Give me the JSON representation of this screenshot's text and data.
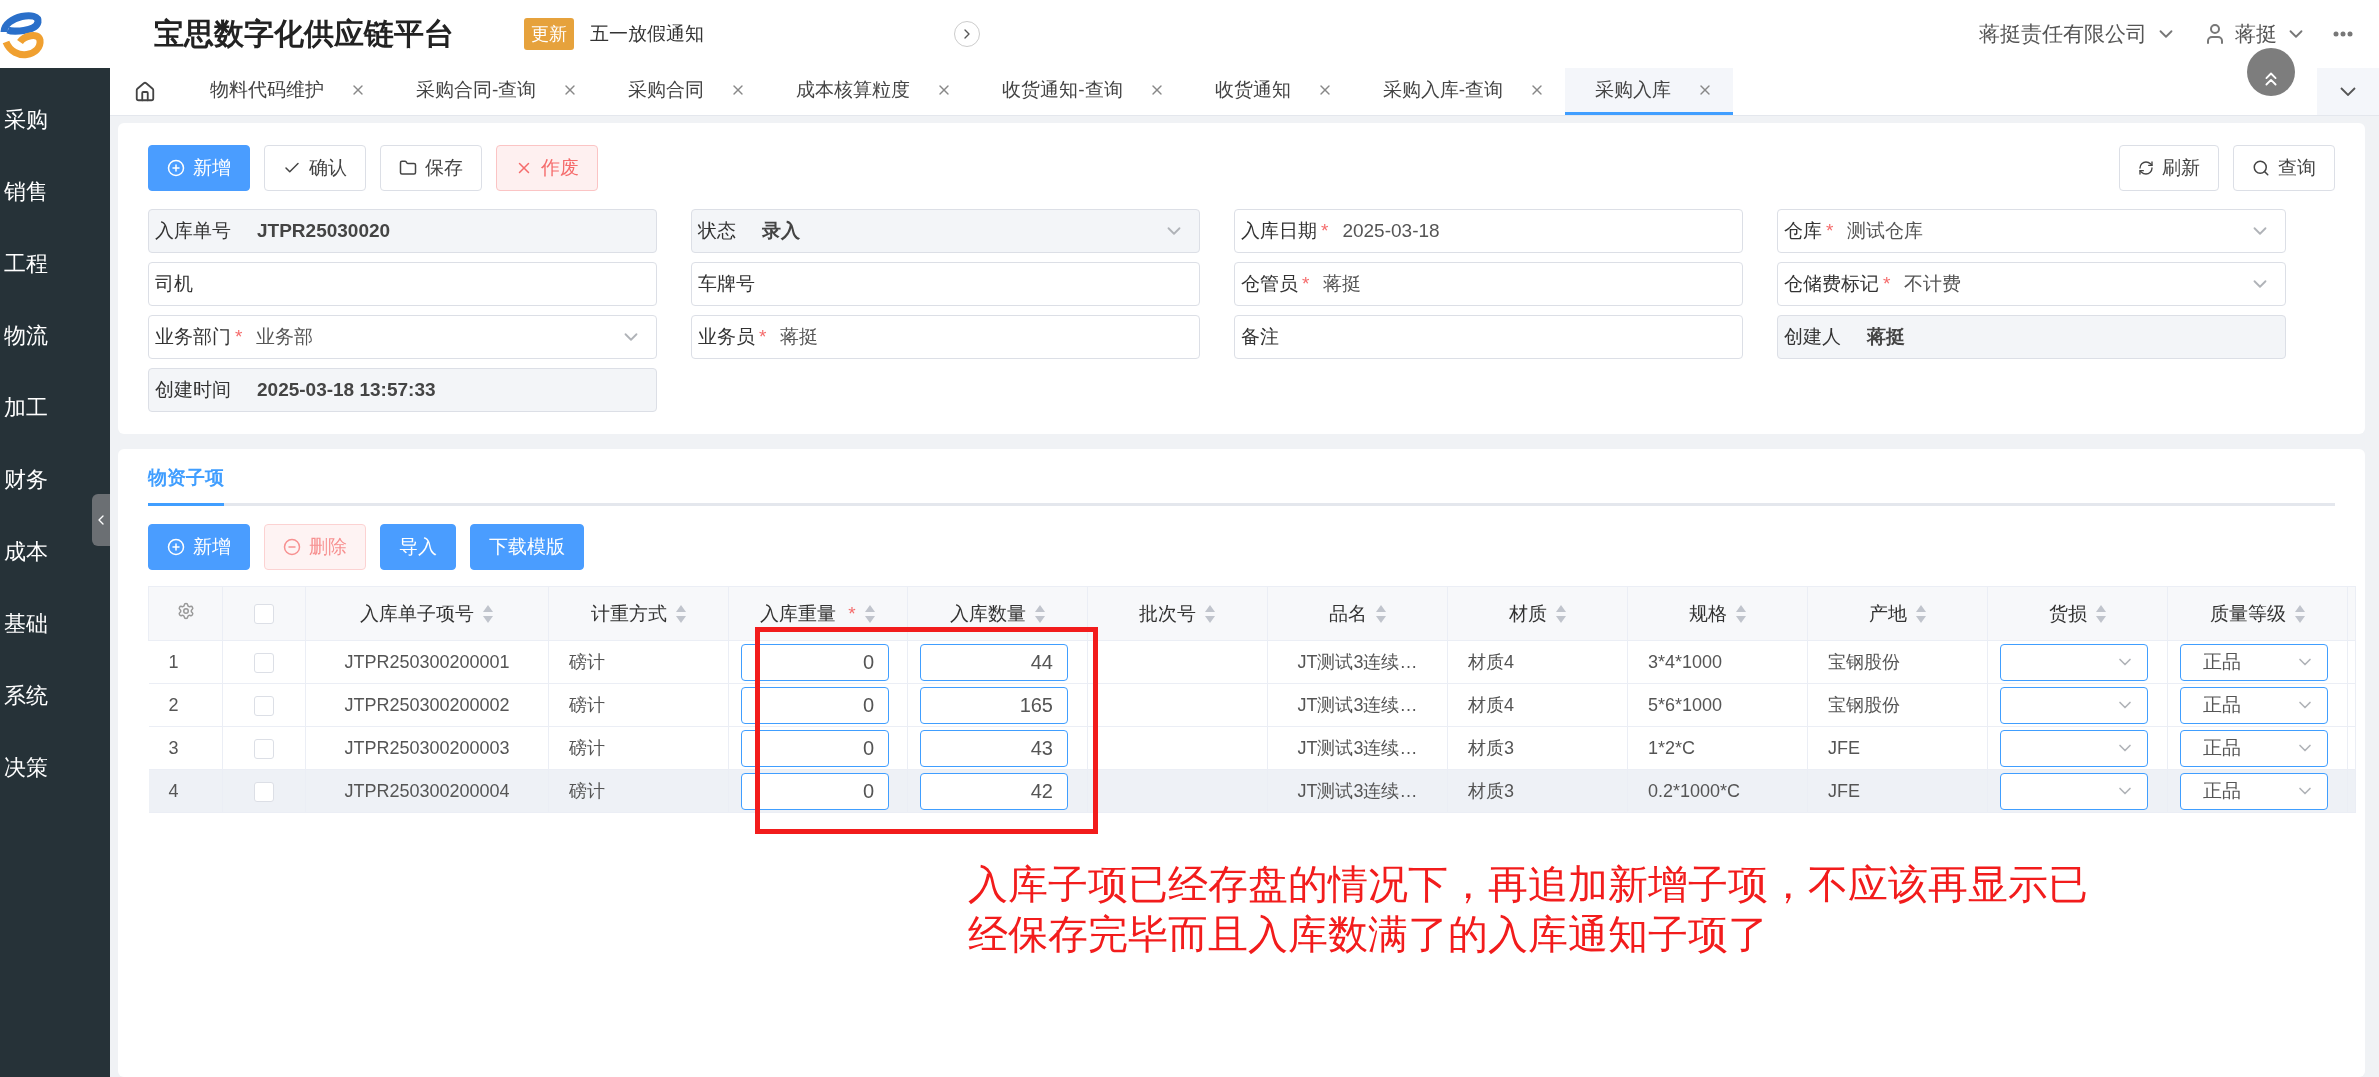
{
  "header": {
    "title": "宝思数字化供应链平台",
    "notice_badge": "更新",
    "notice_text": "五一放假通知",
    "company": "蒋挺责任有限公司",
    "user": "蒋挺"
  },
  "sidebar": {
    "items": [
      {
        "label": "采购"
      },
      {
        "label": "销售"
      },
      {
        "label": "工程"
      },
      {
        "label": "物流"
      },
      {
        "label": "加工"
      },
      {
        "label": "财务"
      },
      {
        "label": "成本"
      },
      {
        "label": "基础"
      },
      {
        "label": "系统"
      },
      {
        "label": "决策"
      }
    ]
  },
  "tabs": [
    {
      "label": "物料代码维护",
      "selected": false
    },
    {
      "label": "采购合同-查询",
      "selected": false
    },
    {
      "label": "采购合同",
      "selected": false
    },
    {
      "label": "成本核算粒度",
      "selected": false
    },
    {
      "label": "收货通知-查询",
      "selected": false
    },
    {
      "label": "收货通知",
      "selected": false
    },
    {
      "label": "采购入库-查询",
      "selected": false
    },
    {
      "label": "采购入库",
      "selected": true
    }
  ],
  "toolbar": {
    "left": [
      {
        "kind": "add",
        "label": "新增"
      },
      {
        "kind": "confirm",
        "label": "确认"
      },
      {
        "kind": "save",
        "label": "保存"
      },
      {
        "kind": "void",
        "label": "作废"
      }
    ],
    "right": [
      {
        "kind": "refresh",
        "label": "刷新"
      },
      {
        "kind": "query",
        "label": "查询"
      }
    ]
  },
  "form": [
    {
      "label": "入库单号",
      "value": "JTPR25030020",
      "kind": "text",
      "readonly": true
    },
    {
      "label": "状态",
      "value": "录入",
      "kind": "select",
      "readonly": true
    },
    {
      "label": "入库日期",
      "value": "2025-03-18",
      "kind": "text",
      "marker": "*",
      "readonly": false
    },
    {
      "label": "仓库",
      "value": "测试仓库",
      "kind": "select",
      "marker": "*",
      "readonly": false
    },
    {
      "label": "司机",
      "kind": "text",
      "readonly": false
    },
    {
      "label": "车牌号",
      "kind": "text",
      "readonly": false
    },
    {
      "label": "仓管员",
      "value": "蒋挺",
      "kind": "text",
      "marker": "*",
      "readonly": false
    },
    {
      "label": "仓储费标记",
      "value": "不计费",
      "kind": "select",
      "marker": "*",
      "readonly": false
    },
    {
      "label": "业务部门",
      "value": "业务部",
      "kind": "select",
      "marker": "*",
      "readonly": false
    },
    {
      "label": "业务员",
      "value": "蒋挺",
      "kind": "text",
      "marker": "*",
      "readonly": false
    },
    {
      "label": "备注",
      "kind": "text",
      "readonly": false
    },
    {
      "label": "创建人",
      "value": "蒋挺",
      "kind": "text",
      "readonly": true
    },
    {
      "label": "创建时间",
      "value": "2025-03-18 13:57:33",
      "kind": "text",
      "readonly": true
    }
  ],
  "items": {
    "tab": "物资子项",
    "toolbar": [
      {
        "kind": "add",
        "label": "新增",
        "disabled": false
      },
      {
        "kind": "delete",
        "label": "删除",
        "disabled": true
      },
      {
        "kind": "import",
        "label": "导入",
        "disabled": false
      },
      {
        "kind": "download",
        "label": "下载模版",
        "disabled": false
      }
    ],
    "table": {
      "all_checked": false,
      "columns": [
        {
          "label": "入库单子项号"
        },
        {
          "label": "计重方式"
        },
        {
          "label": "入库重量",
          "marker": "*"
        },
        {
          "label": "入库数量"
        },
        {
          "label": "批次号"
        },
        {
          "label": "品名"
        },
        {
          "label": "材质"
        },
        {
          "label": "规格"
        },
        {
          "label": "产地"
        },
        {
          "label": "货损"
        },
        {
          "label": "质量等级"
        }
      ],
      "rows": [
        {
          "index": "1",
          "checked": false,
          "hovered": false,
          "code": "JTPR250300200001",
          "method": "磅计",
          "weight": "0",
          "quantity": "44",
          "name": "JT测试3连续…",
          "material": "材质4",
          "spec": "3*4*1000",
          "origin": "宝钢股份",
          "grade": "正品"
        },
        {
          "index": "2",
          "checked": false,
          "hovered": false,
          "code": "JTPR250300200002",
          "method": "磅计",
          "weight": "0",
          "quantity": "165",
          "name": "JT测试3连续…",
          "material": "材质4",
          "spec": "5*6*1000",
          "origin": "宝钢股份",
          "grade": "正品"
        },
        {
          "index": "3",
          "checked": false,
          "hovered": false,
          "code": "JTPR250300200003",
          "method": "磅计",
          "weight": "0",
          "quantity": "43",
          "name": "JT测试3连续…",
          "material": "材质3",
          "spec": "1*2*C",
          "origin": "JFE",
          "grade": "正品"
        },
        {
          "index": "4",
          "checked": false,
          "hovered": true,
          "code": "JTPR250300200004",
          "method": "磅计",
          "weight": "0",
          "quantity": "42",
          "name": "JT测试3连续…",
          "material": "材质3",
          "spec": "0.2*1000*C",
          "origin": "JFE",
          "grade": "正品"
        }
      ]
    }
  },
  "annotation": {
    "text": "入库子项已经存盘的情况下，再追加新增子项，不应该再显示已经保存完毕而且入库数满了的入库通知子项了"
  }
}
